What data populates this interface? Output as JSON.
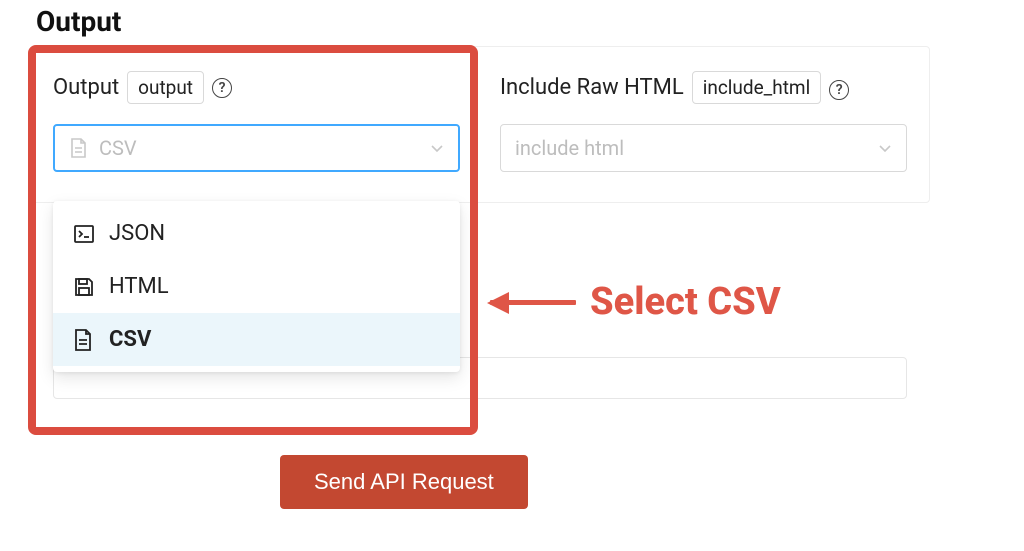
{
  "section_title": "Output",
  "output": {
    "label": "Output",
    "param_name": "output",
    "selected_value": "CSV",
    "options": [
      {
        "label": "JSON",
        "icon": "terminal"
      },
      {
        "label": "HTML",
        "icon": "save"
      },
      {
        "label": "CSV",
        "icon": "file"
      }
    ]
  },
  "include_html": {
    "label": "Include Raw HTML",
    "param_name": "include_html",
    "placeholder": "include html"
  },
  "annotation_text": "Select CSV",
  "primary_button_label": "Send API Request",
  "colors": {
    "accent_red": "#db4c3f",
    "annotation_text": "#df5647",
    "button_bg": "#c34831",
    "select_focus": "#40a9ff"
  }
}
